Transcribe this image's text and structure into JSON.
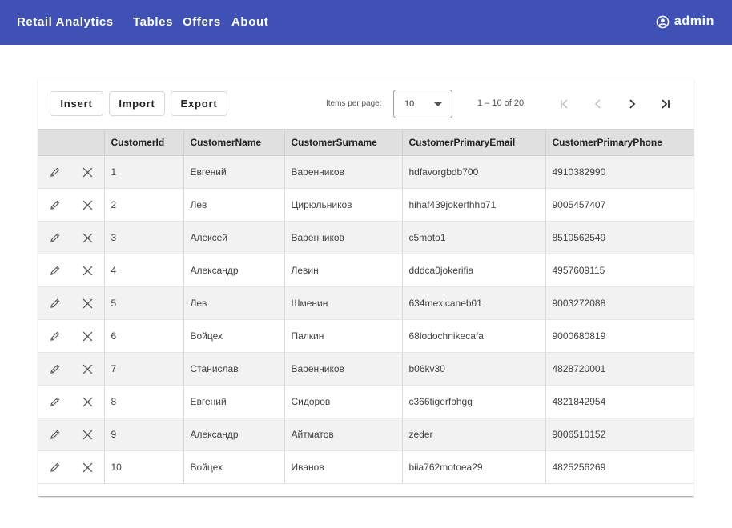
{
  "header": {
    "brand": "Retail Analytics",
    "nav": [
      "Tables",
      "Offers",
      "About"
    ],
    "user_icon": "account-circle-icon",
    "user": "admin",
    "color": "#3f51b5"
  },
  "toolbar": {
    "insert_label": "Insert",
    "import_label": "Import",
    "export_label": "Export",
    "items_per_page_label": "Items per page:",
    "items_per_page_value": "10",
    "range_label": "1 – 10 of 20"
  },
  "pagination_icons": [
    "first-page-icon",
    "previous-page-icon",
    "next-page-icon",
    "last-page-icon"
  ],
  "table": {
    "columns": [
      "CustomerId",
      "CustomerName",
      "CustomerSurname",
      "CustomerPrimaryEmail",
      "CustomerPrimaryPhone"
    ],
    "row_icons": [
      "edit-pencil-icon",
      "delete-x-icon"
    ],
    "rows": [
      [
        "1",
        "Евгений",
        "Варенников",
        "hdfavorgbdb700",
        "4910382990"
      ],
      [
        "2",
        "Лев",
        "Цирюльников",
        "hihaf439jokerfhhb71",
        "9005457407"
      ],
      [
        "3",
        "Алексей",
        "Варенников",
        "c5moto1",
        "8510562549"
      ],
      [
        "4",
        "Александр",
        "Левин",
        "dddca0jokerifia",
        "4957609115"
      ],
      [
        "5",
        "Лев",
        "Шменин",
        "634mexicaneb01",
        "9003272088"
      ],
      [
        "6",
        "Войцех",
        "Палкин",
        "68lodochnikecafa",
        "9000680819"
      ],
      [
        "7",
        "Станислав",
        "Варенников",
        "b06kv30",
        "4828720001"
      ],
      [
        "8",
        "Евгений",
        "Сидоров",
        "c366tigerfbhgg",
        "4821842954"
      ],
      [
        "9",
        "Александр",
        "Айтматов",
        "zeder",
        "9006510152"
      ],
      [
        "10",
        "Войцех",
        "Иванов",
        "biia762motoea29",
        "4825256269"
      ]
    ]
  }
}
